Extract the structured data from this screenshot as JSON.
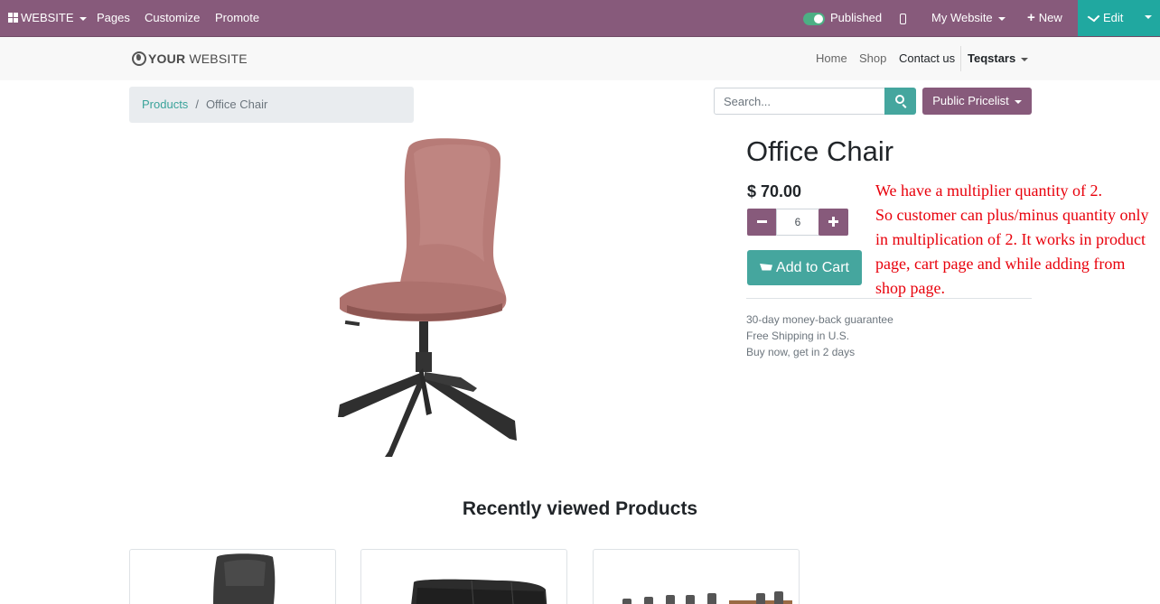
{
  "admin_bar": {
    "website_menu": "WEBSITE",
    "pages": "Pages",
    "customize": "Customize",
    "promote": "Promote",
    "published": "Published",
    "my_website": "My Website",
    "new": "New",
    "edit": "Edit"
  },
  "site_header": {
    "logo_part1": "YOUR",
    "logo_part2": " WEBSITE",
    "nav": [
      "Home",
      "Shop",
      "Contact us"
    ],
    "user": "Teqstars"
  },
  "breadcrumb": {
    "parent": "Products",
    "separator": "/",
    "current": "Office Chair"
  },
  "search": {
    "placeholder": "Search..."
  },
  "pricelist": "Public Pricelist",
  "product": {
    "name": "Office Chair",
    "price": "$ 70.00",
    "quantity": "6",
    "add_to_cart": "Add to Cart",
    "guarantees": [
      "30-day money-back guarantee",
      "Free Shipping in U.S.",
      "Buy now, get in 2 days"
    ]
  },
  "annotation": {
    "line1": "We have a multiplier quantity of 2.",
    "line2": "So customer can plus/minus quantity only in multiplication of 2. It works in product page, cart page and while adding from shop page."
  },
  "recently_viewed": {
    "title": "Recently viewed Products"
  },
  "colors": {
    "brand": "#875a7b",
    "accent": "#45a69e",
    "annotation": "#e8000b"
  }
}
